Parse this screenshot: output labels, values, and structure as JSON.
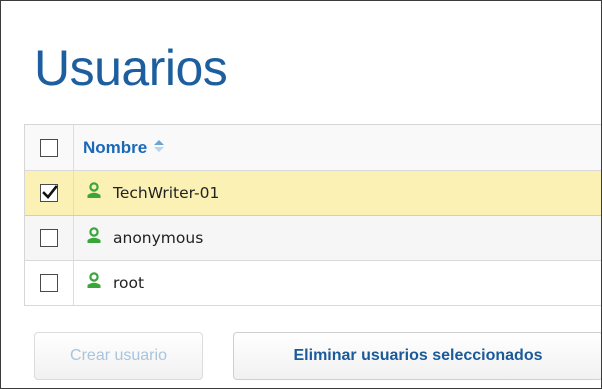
{
  "page": {
    "title": "Usuarios"
  },
  "table": {
    "column_header": "Nombre",
    "sort_icon": "sort-ascending-icon",
    "rows": [
      {
        "name": "TechWriter-01",
        "checked": true,
        "icon": "user-icon"
      },
      {
        "name": "anonymous",
        "checked": false,
        "icon": "user-icon"
      },
      {
        "name": "root",
        "checked": false,
        "icon": "user-icon"
      }
    ]
  },
  "actions": {
    "create_label": "Crear usuario",
    "delete_label": "Eliminar usuarios seleccionados"
  },
  "colors": {
    "title": "#1d5f9e",
    "header_link": "#1b69b6",
    "selected_row": "#fbf1b4",
    "user_icon": "#3aa63a"
  }
}
